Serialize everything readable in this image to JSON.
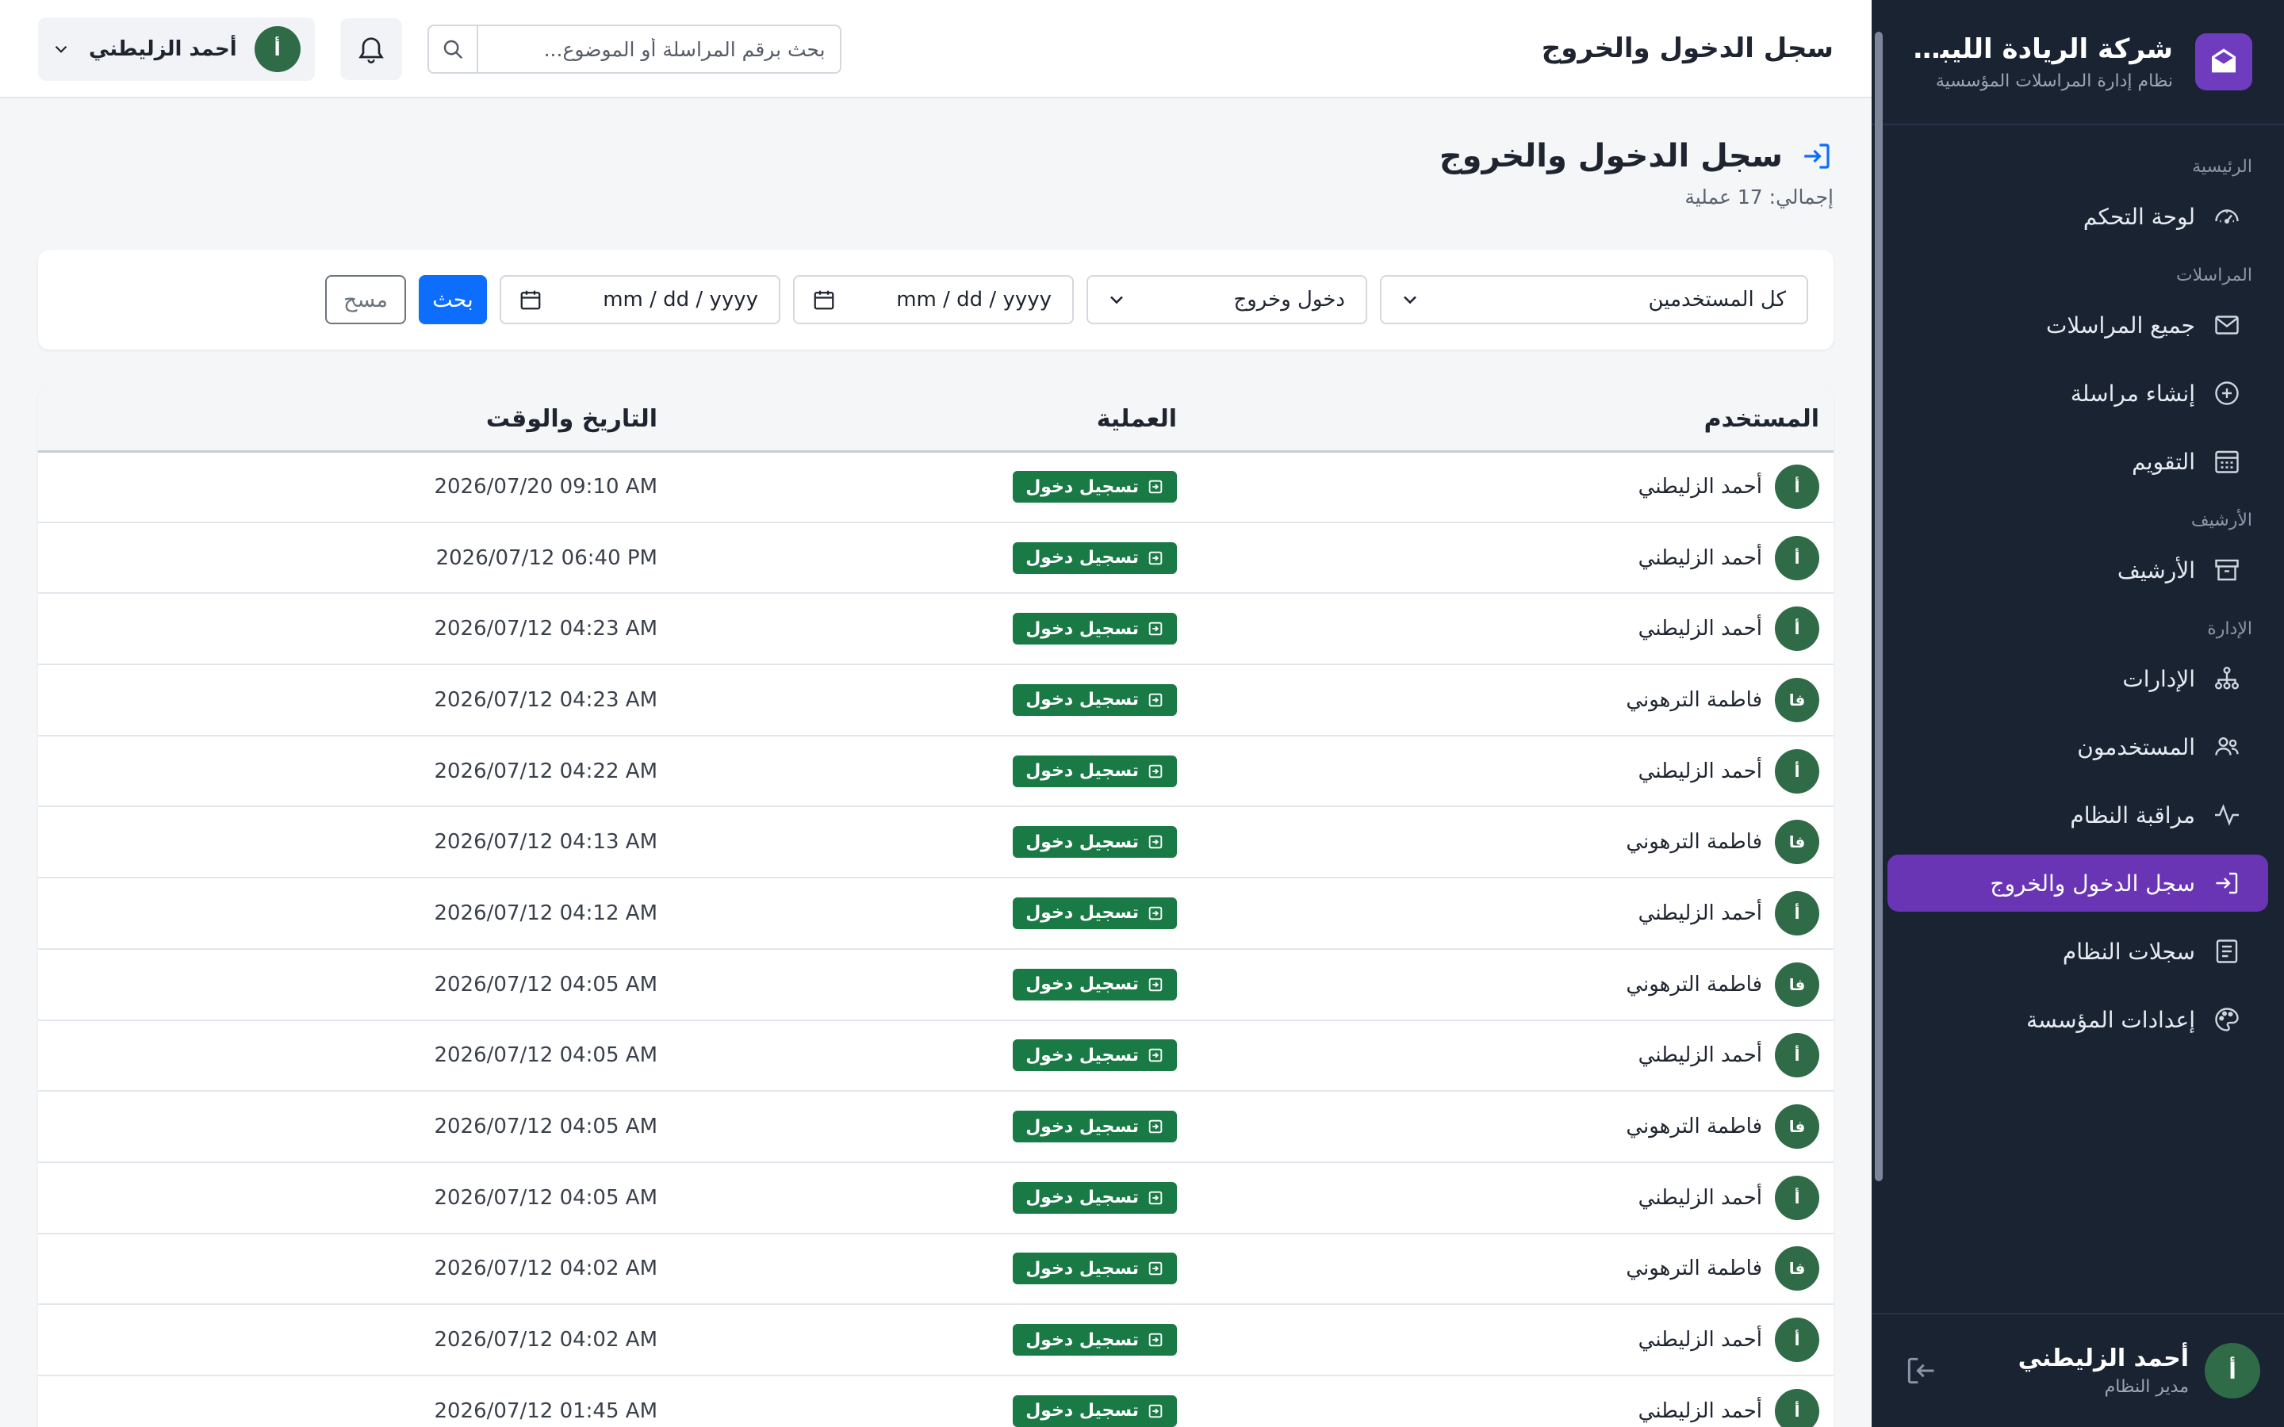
{
  "app": {
    "brand_title": "شركة الريادة الليبية للحلول",
    "brand_subtitle": "نظام إدارة المراسلات المؤسسية"
  },
  "colors": {
    "sidebar_bg": "#1a2332",
    "active_item": "#6a35b4",
    "primary_button": "#0d6efd",
    "badge_green": "#197a45",
    "avatar_green": "#2f6b47"
  },
  "sidebar": {
    "sections": [
      {
        "title": "الرئيسية",
        "items": [
          {
            "label": "لوحة التحكم",
            "icon": "speedometer-icon"
          }
        ]
      },
      {
        "title": "المراسلات",
        "items": [
          {
            "label": "جميع المراسلات",
            "icon": "envelope-icon"
          },
          {
            "label": "إنشاء مراسلة",
            "icon": "plus-circle-icon"
          },
          {
            "label": "التقويم",
            "icon": "calendar-icon"
          }
        ]
      },
      {
        "title": "الأرشيف",
        "items": [
          {
            "label": "الأرشيف",
            "icon": "archive-icon"
          }
        ]
      },
      {
        "title": "الإدارة",
        "items": [
          {
            "label": "الإدارات",
            "icon": "org-chart-icon"
          },
          {
            "label": "المستخدمون",
            "icon": "users-icon"
          },
          {
            "label": "مراقبة النظام",
            "icon": "activity-icon"
          },
          {
            "label": "سجل الدخول والخروج",
            "icon": "login-icon",
            "active": true
          },
          {
            "label": "سجلات النظام",
            "icon": "log-list-icon"
          },
          {
            "label": "إعدادات المؤسسة",
            "icon": "palette-icon"
          }
        ]
      }
    ],
    "user": {
      "name": "أحمد الزليطني",
      "role": "مدير النظام",
      "initial": "أ"
    }
  },
  "header": {
    "title": "سجل الدخول والخروج",
    "search_placeholder": "بحث برقم المراسلة أو الموضوع...",
    "user_name": "أحمد الزليطني",
    "user_initial": "أ"
  },
  "page": {
    "title": "سجل الدخول والخروج",
    "subtitle": "إجمالي: 17 عملية"
  },
  "filters": {
    "user_select": "كل المستخدمين",
    "type_select": "دخول وخروج",
    "date_from_placeholder": "mm / dd / yyyy",
    "date_to_placeholder": "mm / dd / yyyy",
    "search_label": "بحث",
    "clear_label": "مسح"
  },
  "table": {
    "headers": {
      "user": "المستخدم",
      "operation": "العملية",
      "datetime": "التاريخ والوقت"
    },
    "rows": [
      {
        "user": "أحمد الزليطني",
        "initial": "أ",
        "op": "تسجيل دخول",
        "time": "2026/07/20 09:10 AM"
      },
      {
        "user": "أحمد الزليطني",
        "initial": "أ",
        "op": "تسجيل دخول",
        "time": "2026/07/12 06:40 PM"
      },
      {
        "user": "أحمد الزليطني",
        "initial": "أ",
        "op": "تسجيل دخول",
        "time": "2026/07/12 04:23 AM"
      },
      {
        "user": "فاطمة الترهوني",
        "initial": "فا",
        "op": "تسجيل دخول",
        "time": "2026/07/12 04:23 AM"
      },
      {
        "user": "أحمد الزليطني",
        "initial": "أ",
        "op": "تسجيل دخول",
        "time": "2026/07/12 04:22 AM"
      },
      {
        "user": "فاطمة الترهوني",
        "initial": "فا",
        "op": "تسجيل دخول",
        "time": "2026/07/12 04:13 AM"
      },
      {
        "user": "أحمد الزليطني",
        "initial": "أ",
        "op": "تسجيل دخول",
        "time": "2026/07/12 04:12 AM"
      },
      {
        "user": "فاطمة الترهوني",
        "initial": "فا",
        "op": "تسجيل دخول",
        "time": "2026/07/12 04:05 AM"
      },
      {
        "user": "أحمد الزليطني",
        "initial": "أ",
        "op": "تسجيل دخول",
        "time": "2026/07/12 04:05 AM"
      },
      {
        "user": "فاطمة الترهوني",
        "initial": "فا",
        "op": "تسجيل دخول",
        "time": "2026/07/12 04:05 AM"
      },
      {
        "user": "أحمد الزليطني",
        "initial": "أ",
        "op": "تسجيل دخول",
        "time": "2026/07/12 04:05 AM"
      },
      {
        "user": "فاطمة الترهوني",
        "initial": "فا",
        "op": "تسجيل دخول",
        "time": "2026/07/12 04:02 AM"
      },
      {
        "user": "أحمد الزليطني",
        "initial": "أ",
        "op": "تسجيل دخول",
        "time": "2026/07/12 04:02 AM"
      },
      {
        "user": "أحمد الزليطني",
        "initial": "أ",
        "op": "تسجيل دخول",
        "time": "2026/07/12 01:45 AM"
      }
    ]
  }
}
